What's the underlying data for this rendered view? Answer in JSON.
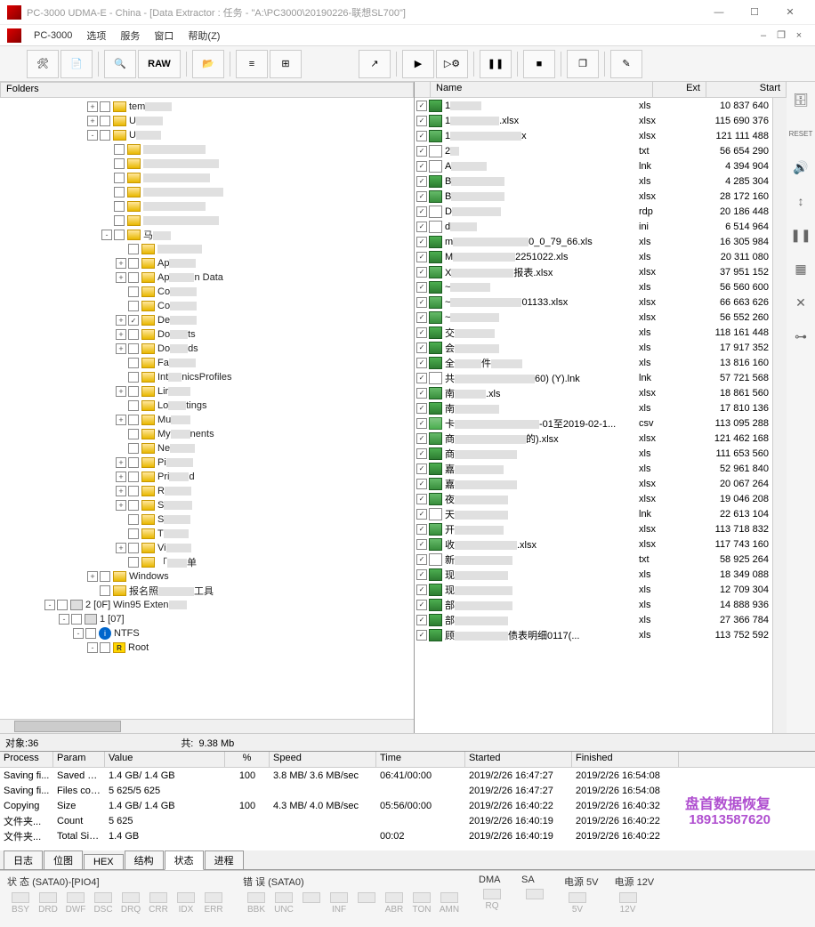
{
  "window": {
    "title": "PC-3000 UDMA-E - China - [Data Extractor : 任务 - \"A:\\PC3000\\20190226-联想SL700\"]"
  },
  "menu": {
    "app": "PC-3000",
    "items": [
      "选项",
      "服务",
      "窗口",
      "帮助(Z)"
    ]
  },
  "toolbar": {
    "raw": "RAW"
  },
  "folders": {
    "header": "Folders",
    "tree": [
      {
        "depth": 6,
        "expand": "+",
        "chk": false,
        "icon": "fldr",
        "label": "tem",
        "redact": 30
      },
      {
        "depth": 6,
        "expand": "+",
        "chk": false,
        "icon": "fldr",
        "label": "U",
        "redact": 30
      },
      {
        "depth": 6,
        "expand": "-",
        "chk": false,
        "icon": "fldr",
        "label": "U",
        "redact": 28
      },
      {
        "depth": 7,
        "expand": "",
        "chk": false,
        "icon": "fldr",
        "label": "",
        "redact": 70
      },
      {
        "depth": 7,
        "expand": "",
        "chk": false,
        "icon": "fldr",
        "label": "",
        "redact": 85
      },
      {
        "depth": 7,
        "expand": "",
        "chk": false,
        "icon": "fldr",
        "label": "",
        "redact": 75
      },
      {
        "depth": 7,
        "expand": "",
        "chk": false,
        "icon": "fldr",
        "label": "",
        "redact": 90
      },
      {
        "depth": 7,
        "expand": "",
        "chk": false,
        "icon": "fldr",
        "label": "",
        "redact": 70
      },
      {
        "depth": 7,
        "expand": "",
        "chk": false,
        "icon": "fldr",
        "label": "",
        "redact": 85
      },
      {
        "depth": 7,
        "expand": "-",
        "chk": false,
        "icon": "fldr",
        "label": "马",
        "redact": 20
      },
      {
        "depth": 8,
        "expand": "",
        "chk": false,
        "icon": "fldr",
        "label": "",
        "redact": 50
      },
      {
        "depth": 8,
        "expand": "+",
        "chk": false,
        "icon": "fldr",
        "label": "Ap",
        "redact": 30
      },
      {
        "depth": 8,
        "expand": "+",
        "chk": false,
        "icon": "fldr",
        "label": "Ap",
        "redact": 28,
        "suffix": "n Data"
      },
      {
        "depth": 8,
        "expand": "",
        "chk": false,
        "icon": "fldr",
        "label": "Co",
        "redact": 30
      },
      {
        "depth": 8,
        "expand": "",
        "chk": false,
        "icon": "fldr",
        "label": "Co",
        "redact": 30
      },
      {
        "depth": 8,
        "expand": "+",
        "chk": true,
        "icon": "fldr",
        "label": "De",
        "redact": 30,
        "sel": true
      },
      {
        "depth": 8,
        "expand": "+",
        "chk": false,
        "icon": "fldr",
        "label": "Do",
        "redact": 20,
        "suffix": "ts"
      },
      {
        "depth": 8,
        "expand": "+",
        "chk": false,
        "icon": "fldr",
        "label": "Do",
        "redact": 20,
        "suffix": "ds"
      },
      {
        "depth": 8,
        "expand": "",
        "chk": false,
        "icon": "fldr",
        "label": "Fa",
        "redact": 30
      },
      {
        "depth": 8,
        "expand": "",
        "chk": false,
        "icon": "fldr",
        "label": "Int",
        "redact": 15,
        "suffix": "nicsProfiles"
      },
      {
        "depth": 8,
        "expand": "+",
        "chk": false,
        "icon": "fldr",
        "label": "Lir",
        "redact": 25
      },
      {
        "depth": 8,
        "expand": "",
        "chk": false,
        "icon": "fldr",
        "label": "Lo",
        "redact": 20,
        "suffix": "tings"
      },
      {
        "depth": 8,
        "expand": "+",
        "chk": false,
        "icon": "fldr",
        "label": "Mu",
        "redact": 22
      },
      {
        "depth": 8,
        "expand": "",
        "chk": false,
        "icon": "fldr",
        "label": "My",
        "redact": 22,
        "suffix": "nents"
      },
      {
        "depth": 8,
        "expand": "",
        "chk": false,
        "icon": "fldr",
        "label": "Ne",
        "redact": 28
      },
      {
        "depth": 8,
        "expand": "+",
        "chk": false,
        "icon": "fldr",
        "label": "Pi",
        "redact": 30
      },
      {
        "depth": 8,
        "expand": "+",
        "chk": false,
        "icon": "fldr",
        "label": "Pri",
        "redact": 22,
        "suffix": "d"
      },
      {
        "depth": 8,
        "expand": "+",
        "chk": false,
        "icon": "fldr",
        "label": "R",
        "redact": 30
      },
      {
        "depth": 8,
        "expand": "+",
        "chk": false,
        "icon": "fldr",
        "label": "S",
        "redact": 32
      },
      {
        "depth": 8,
        "expand": "",
        "chk": false,
        "icon": "fldr",
        "label": "S",
        "redact": 30
      },
      {
        "depth": 8,
        "expand": "",
        "chk": false,
        "icon": "fldr",
        "label": "T",
        "redact": 28
      },
      {
        "depth": 8,
        "expand": "+",
        "chk": false,
        "icon": "fldr",
        "label": "Vi",
        "redact": 28
      },
      {
        "depth": 8,
        "expand": "",
        "chk": false,
        "icon": "fldr",
        "label": "「",
        "redact": 22,
        "suffix": "单"
      },
      {
        "depth": 6,
        "expand": "+",
        "chk": false,
        "icon": "fldr",
        "label": "Windows"
      },
      {
        "depth": 6,
        "expand": "",
        "chk": false,
        "icon": "fldr",
        "label": "报名照",
        "redact": 40,
        "suffix": "工具"
      },
      {
        "depth": 3,
        "expand": "-",
        "chk": false,
        "icon": "drv",
        "label": "2 [0F] Win95 Exten",
        "redact": 20
      },
      {
        "depth": 4,
        "expand": "-",
        "chk": false,
        "icon": "drv",
        "label": "1 [07]"
      },
      {
        "depth": 5,
        "expand": "-",
        "chk": false,
        "icon": "fs",
        "label": "NTFS"
      },
      {
        "depth": 6,
        "expand": "-",
        "chk": false,
        "icon": "root",
        "label": "Root"
      }
    ]
  },
  "filelist": {
    "headers": {
      "name": "Name",
      "ext": "Ext",
      "start": "Start"
    },
    "rows": [
      {
        "name": "1",
        "redact": 35,
        "ext": "xls",
        "start": "10 837 640",
        "icon": "xls"
      },
      {
        "name": "1",
        "redact": 55,
        "suffix": ".xlsx",
        "ext": "xlsx",
        "start": "115 690 376",
        "icon": "xlsx"
      },
      {
        "name": "1",
        "redact": 80,
        "suffix": "x",
        "ext": "xlsx",
        "start": "121 111 488",
        "icon": "xlsx"
      },
      {
        "name": "2",
        "redact": 10,
        "ext": "txt",
        "start": "56 654 290",
        "icon": "txt"
      },
      {
        "name": "A",
        "redact": 40,
        "ext": "lnk",
        "start": "4 394 904",
        "icon": "lnk"
      },
      {
        "name": "B",
        "redact": 60,
        "ext": "xls",
        "start": "4 285 304",
        "icon": "xls"
      },
      {
        "name": "B",
        "redact": 60,
        "ext": "xlsx",
        "start": "28 172 160",
        "icon": "xlsx"
      },
      {
        "name": "D",
        "redact": 55,
        "ext": "rdp",
        "start": "20 186 448",
        "icon": "rdp"
      },
      {
        "name": "d",
        "redact": 30,
        "ext": "ini",
        "start": "6 514 964",
        "icon": "ini"
      },
      {
        "name": "m",
        "redact": 85,
        "suffix": "0_0_79_66.xls",
        "ext": "xls",
        "start": "16 305 984",
        "icon": "xls"
      },
      {
        "name": "M",
        "redact": 70,
        "suffix": "2251022.xls",
        "ext": "xls",
        "start": "20 311 080",
        "icon": "xls"
      },
      {
        "name": "X",
        "redact": 70,
        "suffix": "报表.xlsx",
        "ext": "xlsx",
        "start": "37 951 152",
        "icon": "xlsx"
      },
      {
        "name": "~",
        "redact": 45,
        "ext": "xls",
        "start": "56 560 600",
        "icon": "xls"
      },
      {
        "name": "~",
        "redact": 80,
        "suffix": "01133.xlsx",
        "ext": "xlsx",
        "start": "66 663 626",
        "icon": "xlsx"
      },
      {
        "name": "~",
        "redact": 55,
        "ext": "xlsx",
        "start": "56 552 260",
        "icon": "xlsx"
      },
      {
        "name": "交",
        "redact": 45,
        "ext": "xls",
        "start": "118 161 448",
        "icon": "xls"
      },
      {
        "name": "会",
        "redact": 50,
        "ext": "xls",
        "start": "17 917 352",
        "icon": "xls"
      },
      {
        "name": "全",
        "redact": 30,
        "suffix": "件",
        "redact2": 35,
        "ext": "xls",
        "start": "13 816 160",
        "icon": "xls"
      },
      {
        "name": "共",
        "redact": 90,
        "suffix": "60) (Y).lnk",
        "ext": "lnk",
        "start": "57 721 568",
        "icon": "lnk"
      },
      {
        "name": "南",
        "redact": 35,
        "suffix": ".xls",
        "ext": "xlsx",
        "start": "18 861 560",
        "icon": "xlsx"
      },
      {
        "name": "南",
        "redact": 50,
        "ext": "xls",
        "start": "17 810 136",
        "icon": "xls"
      },
      {
        "name": "卡",
        "redact": 95,
        "suffix": "-01至2019-02-1...",
        "ext": "csv",
        "start": "113 095 288",
        "icon": "csv"
      },
      {
        "name": "商",
        "redact": 80,
        "suffix": "的).xlsx",
        "ext": "xlsx",
        "start": "121 462 168",
        "icon": "xlsx"
      },
      {
        "name": "商",
        "redact": 70,
        "ext": "xls",
        "start": "111 653 560",
        "icon": "xls"
      },
      {
        "name": "嘉",
        "redact": 55,
        "ext": "xls",
        "start": "52 961 840",
        "icon": "xls"
      },
      {
        "name": "嘉",
        "redact": 70,
        "ext": "xlsx",
        "start": "20 067 264",
        "icon": "xlsx"
      },
      {
        "name": "夜",
        "redact": 60,
        "ext": "xlsx",
        "start": "19 046 208",
        "icon": "xlsx"
      },
      {
        "name": "天",
        "redact": 60,
        "ext": "lnk",
        "start": "22 613 104",
        "icon": "lnk"
      },
      {
        "name": "开",
        "redact": 55,
        "ext": "xlsx",
        "start": "113 718 832",
        "icon": "xlsx"
      },
      {
        "name": "收",
        "redact": 70,
        "suffix": ".xlsx",
        "ext": "xlsx",
        "start": "117 743 160",
        "icon": "xlsx"
      },
      {
        "name": "新",
        "redact": 65,
        "ext": "txt",
        "start": "58 925 264",
        "icon": "txt"
      },
      {
        "name": "现",
        "redact": 60,
        "ext": "xls",
        "start": "18 349 088",
        "icon": "xls"
      },
      {
        "name": "现",
        "redact": 65,
        "ext": "xls",
        "start": "12 709 304",
        "icon": "xls"
      },
      {
        "name": "部",
        "redact": 65,
        "ext": "xls",
        "start": "14 888 936",
        "icon": "xls"
      },
      {
        "name": "部",
        "redact": 60,
        "ext": "xls",
        "start": "27 366 784",
        "icon": "xls"
      },
      {
        "name": "顾",
        "redact": 60,
        "suffix": "债表明细0117(...",
        "ext": "xls",
        "start": "113 752 592",
        "icon": "xls"
      }
    ]
  },
  "status": {
    "objects_label": "对象:",
    "objects": "36",
    "total_label": "共:",
    "total": "9.38 Mb"
  },
  "process_table": {
    "headers": {
      "process": "Process",
      "param": "Param",
      "value": "Value",
      "pct": "%",
      "speed": "Speed",
      "time": "Time",
      "started": "Started",
      "finished": "Finished"
    },
    "rows": [
      {
        "process": "Saving fi...",
        "param": "Saved si...",
        "value": "1.4 GB/ 1.4 GB",
        "pct": "100",
        "speed": "3.8 MB/ 3.6 MB/sec",
        "time": "06:41/00:00",
        "started": "2019/2/26 16:47:27",
        "finished": "2019/2/26 16:54:08"
      },
      {
        "process": "Saving fi...",
        "param": "Files cou...",
        "value": "5 625/5 625",
        "pct": "",
        "speed": "",
        "time": "",
        "started": "2019/2/26 16:47:27",
        "finished": "2019/2/26 16:54:08"
      },
      {
        "process": "Copying",
        "param": "Size",
        "value": "1.4 GB/ 1.4 GB",
        "pct": "100",
        "speed": "4.3 MB/ 4.0 MB/sec",
        "time": "05:56/00:00",
        "started": "2019/2/26 16:40:22",
        "finished": "2019/2/26 16:40:32"
      },
      {
        "process": "文件夹...",
        "param": "Count",
        "value": "5 625",
        "pct": "",
        "speed": "",
        "time": "",
        "started": "2019/2/26 16:40:19",
        "finished": "2019/2/26 16:40:22"
      },
      {
        "process": "文件夹...",
        "param": "Total Siz...",
        "value": "1.4 GB",
        "pct": "",
        "speed": "",
        "time": "00:02",
        "started": "2019/2/26 16:40:19",
        "finished": "2019/2/26 16:40:22"
      }
    ]
  },
  "tabs": [
    "日志",
    "位图",
    "HEX",
    "结构",
    "状态",
    "进程"
  ],
  "active_tab": 4,
  "hardware": {
    "status_label": "状 态 (SATA0)-[PIO4]",
    "status_leds": [
      "BSY",
      "DRD",
      "DWF",
      "DSC",
      "DRQ",
      "CRR",
      "IDX",
      "ERR"
    ],
    "error_label": "错 误 (SATA0)",
    "error_leds": [
      "BBK",
      "UNC",
      "",
      "INF",
      "",
      "ABR",
      "TON",
      "AMN"
    ],
    "dma_label": "DMA",
    "dma_leds": [
      "RQ"
    ],
    "sa_label": "SA",
    "sa_leds": [
      ""
    ],
    "p5_label": "电源 5V",
    "p5_leds": [
      "5V"
    ],
    "p12_label": "电源 12V",
    "p12_leds": [
      "12V"
    ]
  },
  "watermark": {
    "line1": "盘首数据恢复",
    "line2": "18913587620"
  }
}
